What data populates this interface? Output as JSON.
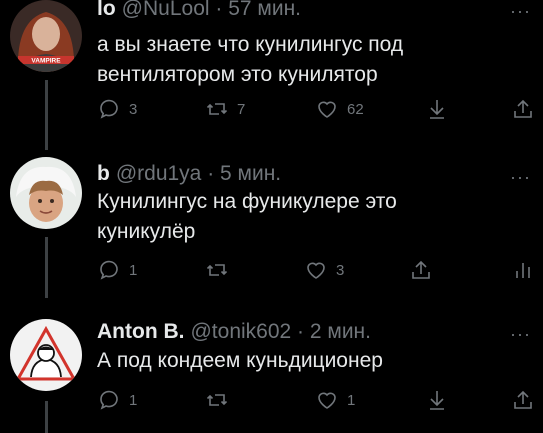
{
  "tweets": [
    {
      "name": "lo",
      "handle": "@NuLool",
      "time": "· 57 мин.",
      "text": "а вы знаете что кунилингус под вентилятором это кунилятор",
      "replies": "3",
      "retweets": "7",
      "likes": "62",
      "avatar_label": "VAMPIRE"
    },
    {
      "name": "b",
      "handle": "@rdu1ya",
      "time": "· 5 мин.",
      "text": "Кунилингус на фуникулере это куникулёр",
      "replies": "1",
      "retweets": "",
      "likes": "3"
    },
    {
      "name": "Anton B.",
      "handle": "@tonik602",
      "time": "· 2 мин.",
      "text": "А под кондеем куньдиционер",
      "replies": "1",
      "retweets": "",
      "likes": "1"
    }
  ],
  "colors": {
    "background": "#000000",
    "text": "#e7e9ea",
    "muted": "#71767b",
    "thread": "#3d4144"
  },
  "icons": [
    "reply-icon",
    "retweet-icon",
    "like-icon",
    "save-icon",
    "share-icon",
    "analytics-icon",
    "more-icon"
  ]
}
